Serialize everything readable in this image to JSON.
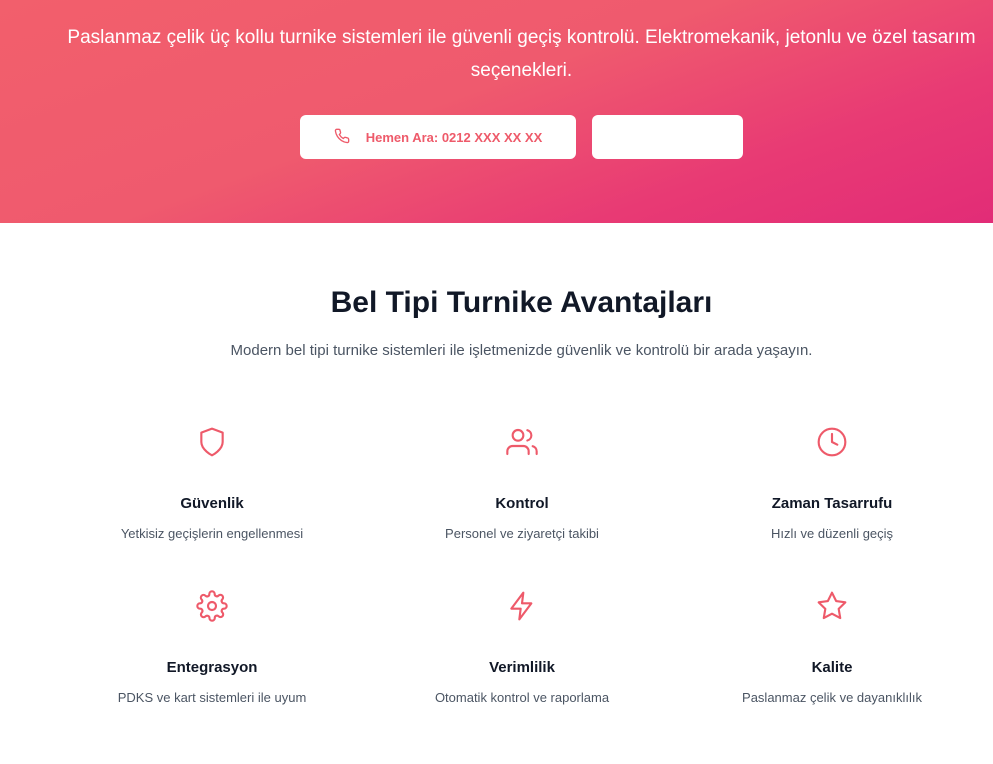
{
  "hero": {
    "description": "Paslanmaz çelik üç kollu turnike sistemleri ile güvenli geçiş kontrolü. Elektromekanik, jetonlu ve özel tasarım seçenekleri.",
    "call_button_label": "Hemen Ara: 0212 XXX XX XX",
    "secondary_button_label": "",
    "gradient_start": "#f25f6c",
    "gradient_end": "#e22c77"
  },
  "advantages": {
    "title": "Bel Tipi Turnike Avantajları",
    "subtitle": "Modern bel tipi turnike sistemleri ile işletmenizde güvenlik ve kontrolü bir arada yaşayın.",
    "accent_color": "#ee5a6a",
    "items": [
      {
        "icon": "shield-icon",
        "title": "Güvenlik",
        "description": "Yetkisiz geçişlerin engellenmesi"
      },
      {
        "icon": "users-icon",
        "title": "Kontrol",
        "description": "Personel ve ziyaretçi takibi"
      },
      {
        "icon": "clock-icon",
        "title": "Zaman Tasarrufu",
        "description": "Hızlı ve düzenli geçiş"
      },
      {
        "icon": "gear-icon",
        "title": "Entegrasyon",
        "description": "PDKS ve kart sistemleri ile uyum"
      },
      {
        "icon": "lightning-icon",
        "title": "Verimlilik",
        "description": "Otomatik kontrol ve raporlama"
      },
      {
        "icon": "star-icon",
        "title": "Kalite",
        "description": "Paslanmaz çelik ve dayanıklılık"
      }
    ]
  }
}
